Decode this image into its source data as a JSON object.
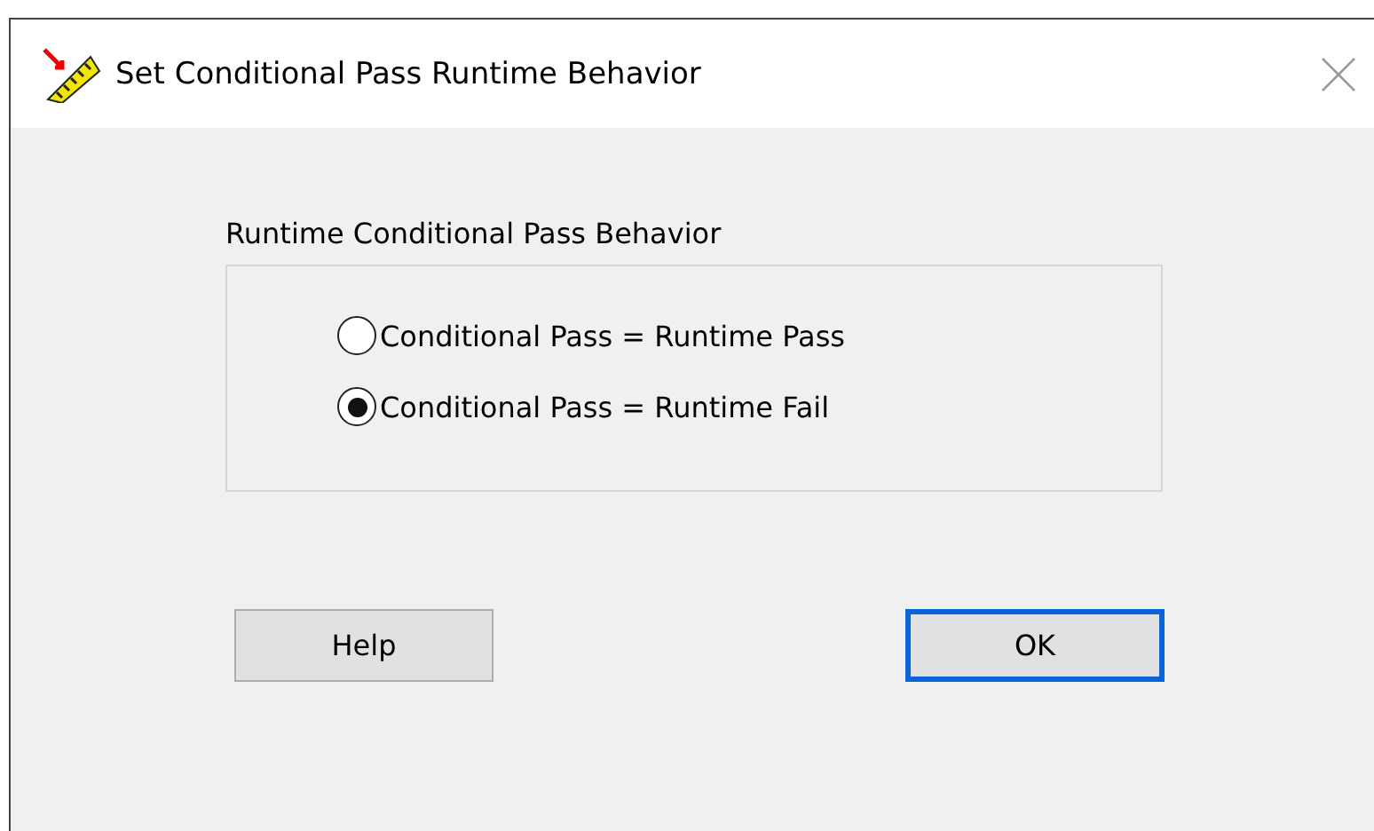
{
  "window": {
    "title": "Set Conditional Pass Runtime Behavior"
  },
  "group": {
    "label": "Runtime Conditional Pass Behavior",
    "options": [
      {
        "label": "Conditional Pass = Runtime Pass",
        "selected": false
      },
      {
        "label": "Conditional Pass = Runtime Fail",
        "selected": true
      }
    ]
  },
  "buttons": [
    {
      "label": "Help",
      "default": false
    },
    {
      "label": "OK",
      "default": true
    }
  ]
}
